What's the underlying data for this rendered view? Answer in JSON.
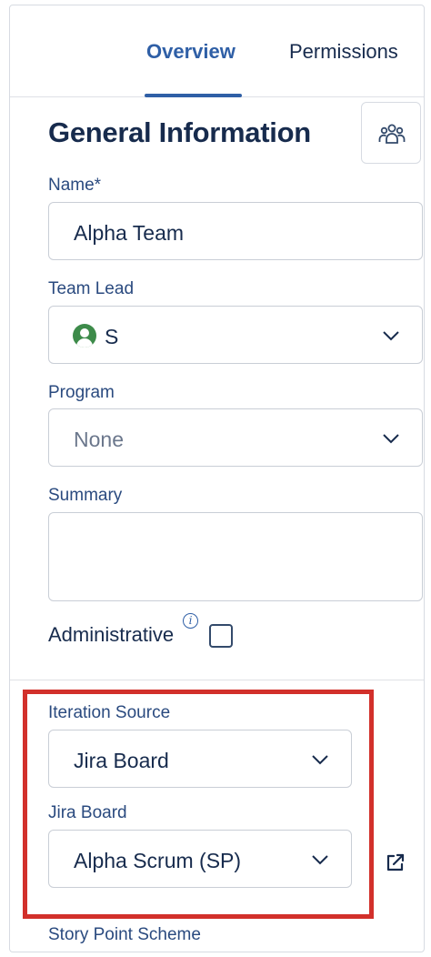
{
  "tabs": {
    "overview": "Overview",
    "permissions": "Permissions"
  },
  "section": {
    "title": "General Information"
  },
  "fields": {
    "name": {
      "label": "Name*",
      "value": "Alpha Team"
    },
    "team_lead": {
      "label": "Team Lead",
      "value": "S"
    },
    "program": {
      "label": "Program",
      "value": "None"
    },
    "summary": {
      "label": "Summary",
      "value": ""
    },
    "administrative": {
      "label": "Administrative",
      "checked": false
    },
    "iteration_source": {
      "label": "Iteration Source",
      "value": "Jira Board"
    },
    "jira_board": {
      "label": "Jira Board",
      "value": "Alpha Scrum (SP)"
    },
    "story_point_scheme": {
      "label": "Story Point Scheme"
    }
  },
  "icons": {
    "team": "team-icon",
    "chevron": "chevron-down-icon",
    "info": "info-icon",
    "external": "external-link-icon",
    "avatar": "user-avatar-icon"
  },
  "colors": {
    "accent": "#2f5fa6",
    "label": "#2a4a7f",
    "highlight": "#d2302b",
    "avatar": "#3d8b4a"
  }
}
